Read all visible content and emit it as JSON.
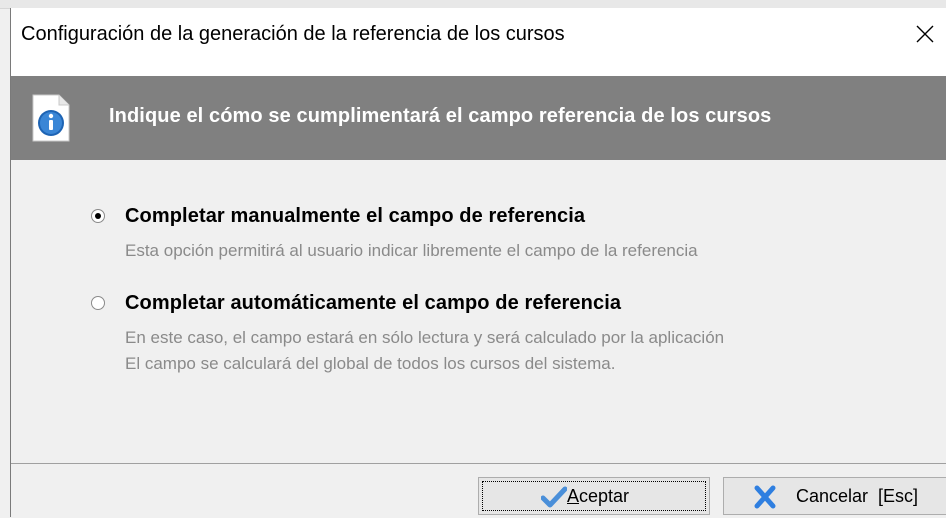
{
  "window": {
    "title": "Configuración de la generación de la referencia de los cursos"
  },
  "banner": {
    "icon": "info-icon",
    "text": "Indique el cómo se cumplimentará el campo referencia de los cursos"
  },
  "options": [
    {
      "label": "Completar manualmente el campo de referencia",
      "checked": true,
      "description": [
        "Esta opción permitirá al usuario indicar libremente el campo de la referencia"
      ]
    },
    {
      "label": "Completar automáticamente el campo de referencia",
      "checked": false,
      "description": [
        "En este caso, el campo estará en sólo lectura y será calculado por la aplicación",
        "El campo se calculará del global de todos los cursos del sistema."
      ]
    }
  ],
  "buttons": {
    "accept": {
      "mnemonic": "A",
      "rest": "ceptar",
      "icon": "checkmark-icon",
      "focused": true
    },
    "cancel": {
      "label": "Cancelar  [Esc]",
      "icon": "cross-icon"
    }
  },
  "colors": {
    "banner_bg": "#808080",
    "description_text": "#8a8a8a",
    "checkmark": "#4a8fd9",
    "cross": "#2f7fe0"
  }
}
